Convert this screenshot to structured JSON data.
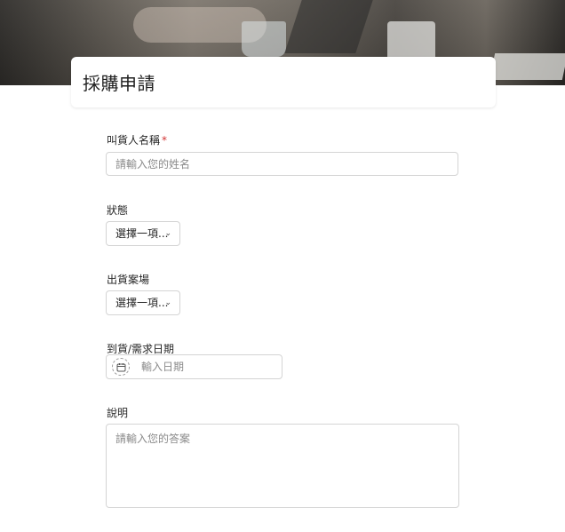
{
  "form": {
    "title": "採購申請",
    "fields": {
      "requester": {
        "label": "叫貨人名稱",
        "required_mark": "*",
        "placeholder": "請輸入您的姓名"
      },
      "status": {
        "label": "狀態",
        "selected": "選擇一項...",
        "chevron": "⌄"
      },
      "shipping_site": {
        "label": "出貨案場",
        "selected": "選擇一項...",
        "chevron": "⌄"
      },
      "due_date": {
        "label": "到貨/需求日期",
        "placeholder": "輸入日期",
        "icon": "calendar-icon"
      },
      "description": {
        "label": "說明",
        "placeholder": "請輸入您的答案"
      }
    }
  },
  "colors": {
    "required": "#d23232",
    "border": "#d4d4d4",
    "placeholder": "#8a8a8a"
  }
}
